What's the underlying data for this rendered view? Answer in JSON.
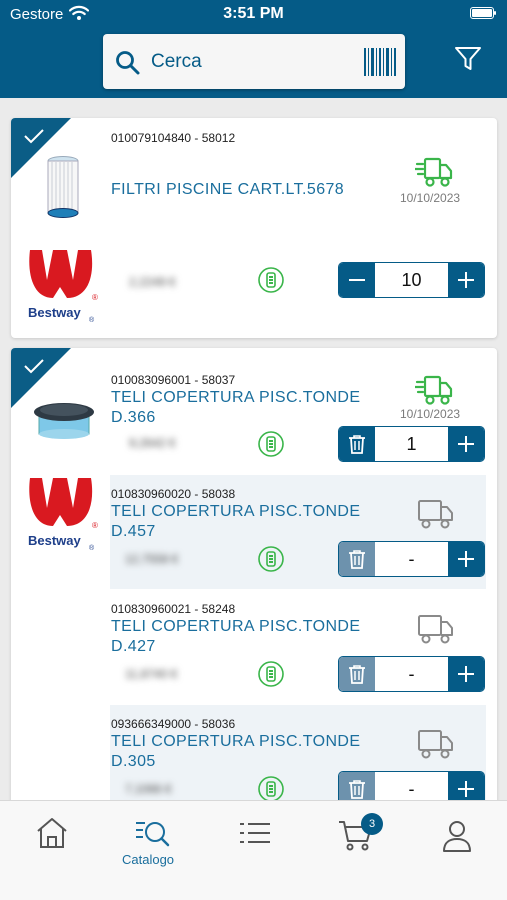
{
  "status_bar": {
    "carrier": "Gestore",
    "time": "3:51 PM"
  },
  "search": {
    "placeholder": "Cerca"
  },
  "colors": {
    "brand": "#055b87",
    "link": "#1a6e9d",
    "in_stock": "#3ab54a",
    "unavailable": "#8a8a8a"
  },
  "products": [
    {
      "code": "010079104840 - 58012",
      "name": "FILTRI PISCINE CART.LT.5678",
      "date": "10/10/2023",
      "price": "2,2249 €",
      "quantity": "10",
      "brand": "Bestway"
    },
    {
      "code": "010083096001 - 58037",
      "name_line1": "TELI COPERTURA PISC.TONDE",
      "name_line2": "D.366",
      "date": "10/10/2023",
      "price": "9,2642 €",
      "quantity": "1",
      "brand": "Bestway",
      "variants": [
        {
          "code": "010830960020 - 58038",
          "name_line1": "TELI COPERTURA PISC.TONDE",
          "name_line2": "D.457",
          "price": "12,7558 €",
          "quantity": "-"
        },
        {
          "code": "010830960021 - 58248",
          "name_line1": "TELI COPERTURA PISC.TONDE",
          "name_line2": "D.427",
          "price": "11,8740 €",
          "quantity": "-"
        },
        {
          "code": "093666349000 - 58036",
          "name_line1": "TELI COPERTURA PISC.TONDE",
          "name_line2": "D.305",
          "price": "7,1066 €",
          "quantity": "-"
        }
      ]
    }
  ],
  "tabbar": {
    "active_label": "Catalogo",
    "cart_count": "3"
  }
}
